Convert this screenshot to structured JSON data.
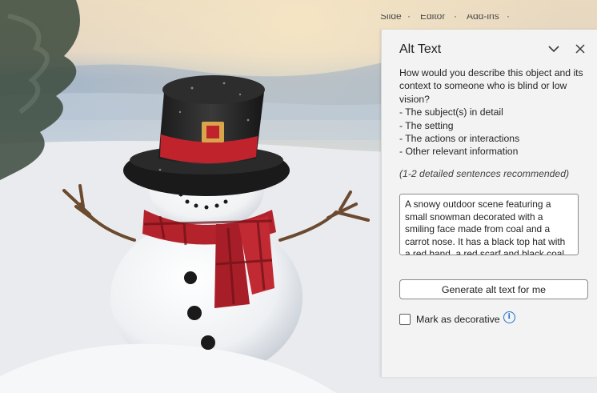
{
  "ribbon": {
    "items": [
      "Slide",
      "Editor",
      "Add-ins"
    ]
  },
  "alt_text_pane": {
    "title": "Alt Text",
    "collapse_icon": "chevron-down-icon",
    "close_icon": "close-icon",
    "prompt_lines": [
      "How would you describe this object and its",
      "context to someone who is blind or low",
      "vision?",
      "- The subject(s) in detail",
      "- The setting",
      "- The actions or interactions",
      "- Other relevant information"
    ],
    "hint": "(1-2 detailed sentences recommended)",
    "description_value": "A snowy outdoor scene featuring a small snowman decorated with a smiling face made from coal and a carrot nose. It has a black top hat with a red band, a red scarf and black coal buttons.",
    "generate_button_label": "Generate alt text for me",
    "decorative_label": "Mark as decorative",
    "decorative_checked": false,
    "info_icon": "info-icon"
  }
}
